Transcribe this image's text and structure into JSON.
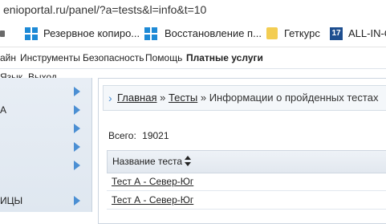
{
  "browser": {
    "url": "enioportal.ru/panel/?a=tests&l=info&t=10"
  },
  "bookmarks": [
    {
      "label": "Резервное копиро...",
      "icon": "windows-icon"
    },
    {
      "label": "Восстановление п...",
      "icon": "windows-icon"
    },
    {
      "label": "Геткурс",
      "icon": "folder-icon"
    },
    {
      "label": "ALL-IN-C",
      "icon": "seventeen-icon",
      "badge": "17"
    }
  ],
  "menu": {
    "items": [
      "айн",
      "Инструменты",
      "Безопасность",
      "Помощь",
      "Платные услуги"
    ],
    "submenu": [
      "Язык",
      "Выход"
    ]
  },
  "sidebar": {
    "rows": [
      {
        "label": ""
      },
      {
        "label": "А"
      },
      {
        "label": ""
      },
      {
        "label": ""
      },
      {
        "label": ""
      },
      {
        "label": "ИЦЫ"
      }
    ]
  },
  "breadcrumb": {
    "chevron": "›",
    "home": "Главная",
    "sep1": "»",
    "tests": "Тесты",
    "sep2": "»",
    "current": "Информации о пройденных тестах"
  },
  "content": {
    "total_label": "Всего:",
    "total_value": "19021",
    "column_header": "Название теста",
    "rows": [
      "Тест А - Север-Юг",
      "Тест А - Север-Юг"
    ]
  },
  "colors": {
    "accent": "#4b8fd3",
    "windows": "#1e8ad6"
  }
}
